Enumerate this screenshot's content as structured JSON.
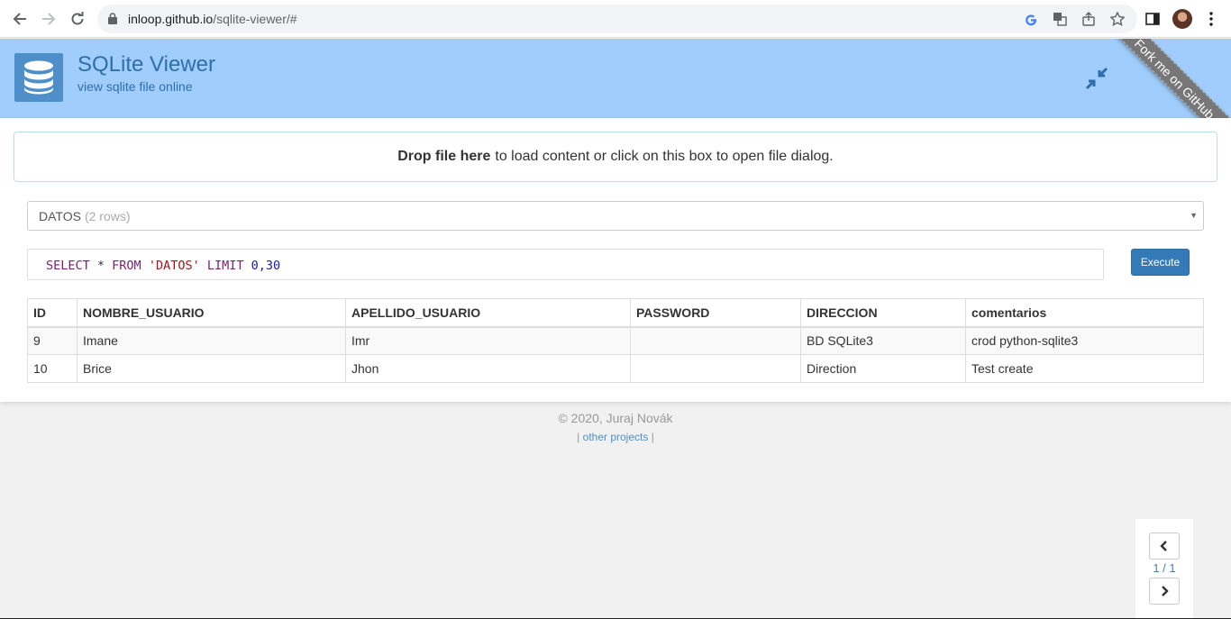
{
  "browser": {
    "url_host": "inloop.github.io",
    "url_path": "/sqlite-viewer/#"
  },
  "header": {
    "title": "SQLite Viewer",
    "subtitle": "view sqlite file online",
    "ribbon": "Fork me on GitHub"
  },
  "dropzone": {
    "bold": "Drop file here",
    "text": "to load content or click on this box to open file dialog."
  },
  "table_select": {
    "name": "DATOS",
    "rows": "(2 rows)"
  },
  "query": {
    "select": "SELECT",
    "star": " * ",
    "from": "FROM",
    "table": "'DATOS'",
    "limit": "LIMIT",
    "range": "0,30"
  },
  "execute_label": "Execute",
  "results": {
    "columns": [
      "ID",
      "NOMBRE_USUARIO",
      "APELLIDO_USUARIO",
      "PASSWORD",
      "DIRECCION",
      "comentarios"
    ],
    "rows": [
      [
        "9",
        "Imane",
        "Imr",
        "",
        "BD SQLite3",
        "crod python-sqlite3"
      ],
      [
        "10",
        "Brice",
        "Jhon",
        "",
        "Direction",
        "Test create"
      ]
    ]
  },
  "footer": {
    "copyright": "© 2020, Juraj Novák",
    "pipe_left": "|",
    "other_projects": "other projects",
    "pipe_right": "|"
  },
  "pager": {
    "text": "1 / 1"
  },
  "colors": {
    "header_bg": "#a0cdfc",
    "brand": "#2f6fa9",
    "button": "#337ab7"
  }
}
